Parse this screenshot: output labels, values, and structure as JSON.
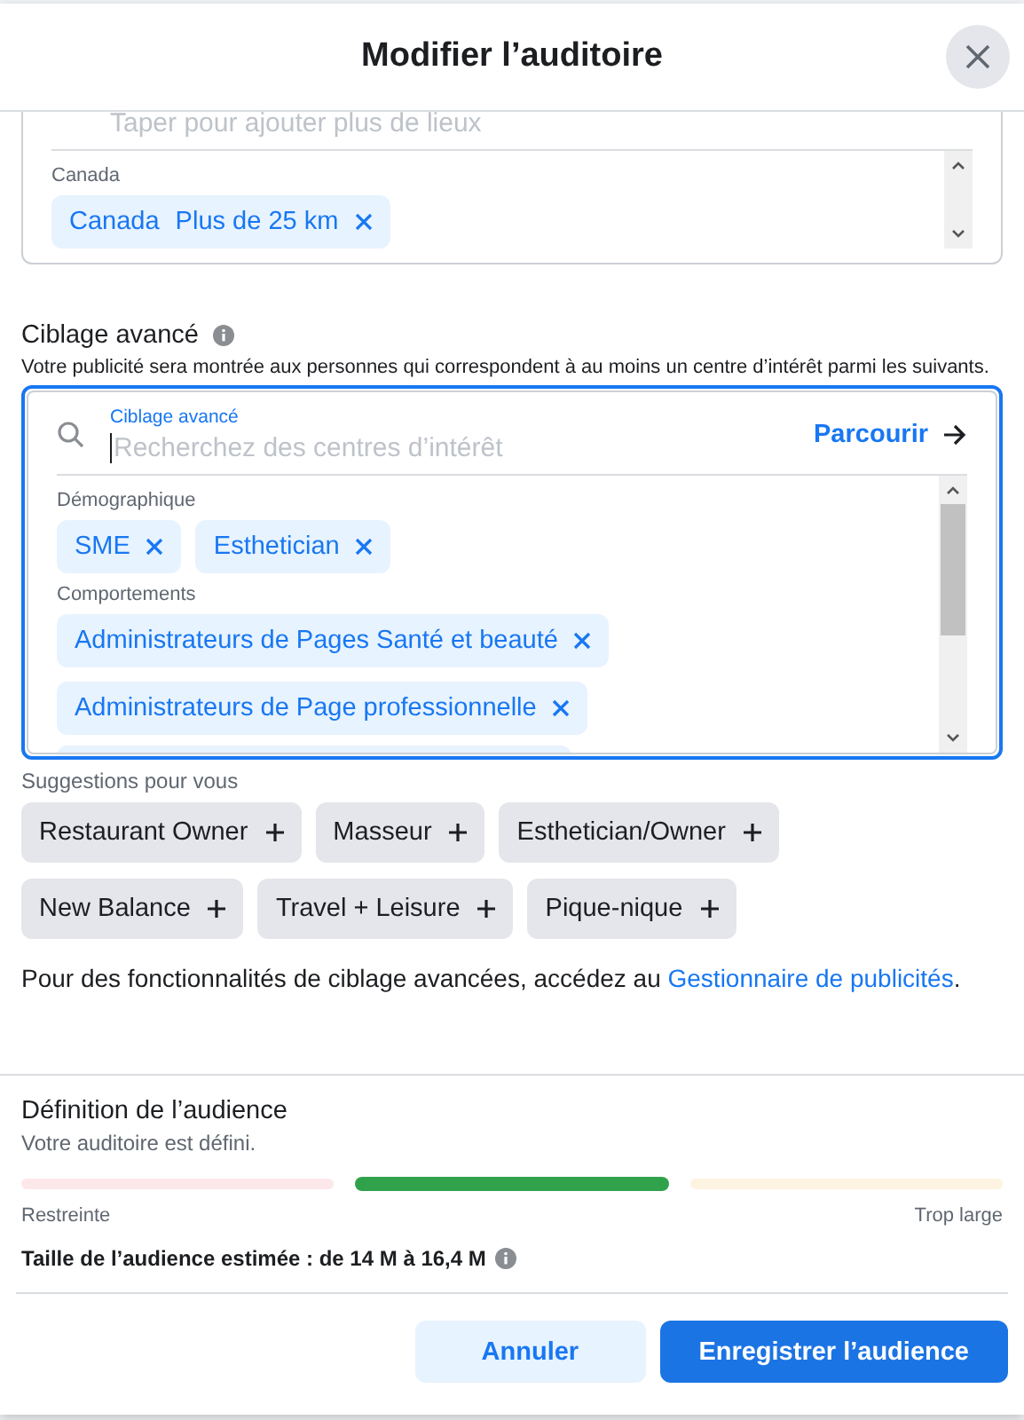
{
  "dialog": {
    "title": "Modifier l’auditoire"
  },
  "location": {
    "placeholder": "Taper pour ajouter plus de lieux",
    "group_label": "Canada",
    "chips": [
      {
        "name": "Canada",
        "detail": "Plus de 25 km"
      }
    ]
  },
  "targeting": {
    "title": "Ciblage avancé",
    "description": "Votre publicité sera montrée aux personnes qui correspondent à au moins un centre d’intérêt parmi les suivants.",
    "search_label": "Ciblage avancé",
    "placeholder": "Recherchez des centres d’intérêt",
    "browse": "Parcourir",
    "groups": [
      {
        "label": "Démographique",
        "chips": [
          "SME",
          "Esthetician"
        ]
      },
      {
        "label": "Comportements",
        "chips": [
          "Administrateurs de Pages Santé et beauté",
          "Administrateurs de Page professionnelle"
        ]
      }
    ]
  },
  "suggestions": {
    "title": "Suggestions pour vous",
    "items": [
      "Restaurant Owner",
      "Masseur",
      "Esthetician/Owner",
      "New Balance",
      "Travel + Leisure",
      "Pique-nique"
    ]
  },
  "footer_note": {
    "text": "Pour des fonctionnalités de ciblage avancées, accédez au ",
    "link": "Gestionnaire de publicités",
    "end": "."
  },
  "audience": {
    "title": "Définition de l’audience",
    "status": "Votre auditoire est défini.",
    "segments": [
      {
        "color": "#fce8ea",
        "selected": false
      },
      {
        "color": "#31a24c",
        "selected": true
      },
      {
        "color": "#fdf3e1",
        "selected": false
      }
    ],
    "low_label": "Restreinte",
    "high_label": "Trop large",
    "estimate": "Taille de l’audience estimée : de 14 M à 16,4 M"
  },
  "buttons": [
    {
      "label": "Annuler",
      "kind": "secondary"
    },
    {
      "label": "Enregistrer l’audience",
      "kind": "primary"
    }
  ]
}
